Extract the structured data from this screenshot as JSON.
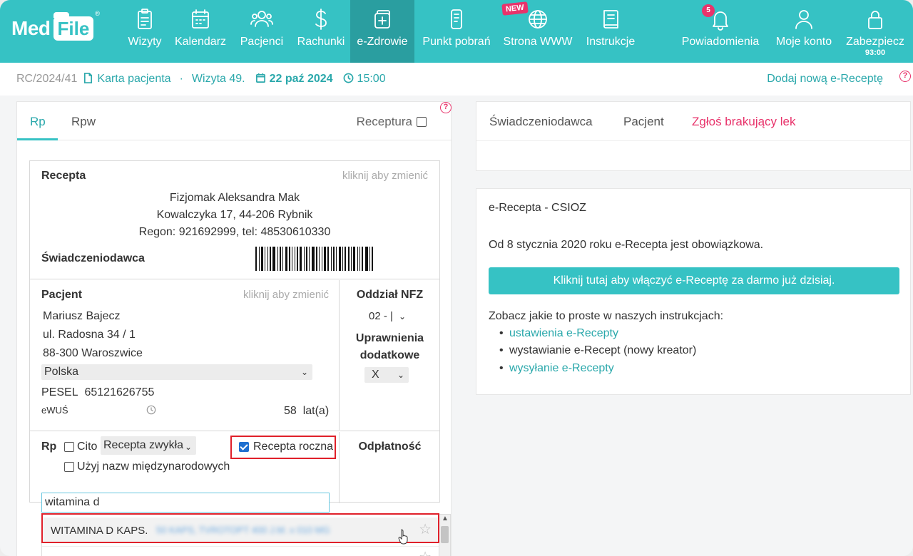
{
  "brand": {
    "logo_part1": "Med",
    "logo_part2": "File",
    "reg_mark": "®"
  },
  "nav": {
    "items": [
      {
        "label": "Wizyty",
        "icon": "clipboard-icon"
      },
      {
        "label": "Kalendarz",
        "icon": "calendar-icon"
      },
      {
        "label": "Pacjenci",
        "icon": "users-icon"
      },
      {
        "label": "Rachunki",
        "icon": "dollar-icon"
      },
      {
        "label": "e-Zdrowie",
        "icon": "medical-plus-icon",
        "active": true
      },
      {
        "label": "Punkt pobrań",
        "icon": "test-tube-icon"
      },
      {
        "label": "Strona WWW",
        "icon": "globe-icon",
        "badge": "NEW"
      },
      {
        "label": "Instrukcje",
        "icon": "book-icon"
      }
    ],
    "right_items": [
      {
        "label": "Powiadomienia",
        "icon": "bell-icon",
        "count": "5"
      },
      {
        "label": "Moje konto",
        "icon": "user-icon"
      },
      {
        "label": "Zabezpiecz",
        "icon": "lock-icon",
        "timer": "93:00"
      }
    ]
  },
  "breadcrumb": {
    "id": "RC/2024/41",
    "card": "Karta pacjenta",
    "sep": "·",
    "visit": "Wizyta 49.",
    "date": "22 paź 2024",
    "time": "15:00",
    "right_link": "Dodaj nową e-Receptę",
    "help": "?"
  },
  "left": {
    "tabs": [
      "Rp",
      "Rpw"
    ],
    "receptura_label": "Receptura",
    "help": "?",
    "recepta": {
      "title": "Recepta",
      "hint": "kliknij aby zmienić",
      "lines": [
        "Fizjomak Aleksandra Mak",
        "Kowalczyka  17, 44-206 Rybnik",
        "Regon: 921692999, tel: 48530610330"
      ],
      "provider_label": "Świadczeniodawca"
    },
    "patient": {
      "title": "Pacjent",
      "hint": "kliknij aby zmienić",
      "name": "Mariusz Bajecz",
      "street": "ul. Radosna 34 / 1",
      "city": "88-300 Waroszwice",
      "country": "Polska",
      "pesel_label": "PESEL",
      "pesel": "65121626755",
      "ewus": "eWUŚ",
      "age": "58",
      "age_unit": "lat(a)"
    },
    "nfz": {
      "title": "Oddział NFZ",
      "value": "02 - |",
      "perm_title_1": "Uprawnienia",
      "perm_title_2": "dodatkowe",
      "perm_value": "X"
    },
    "rp": {
      "label": "Rp",
      "cito_label": "Cito",
      "type_value": "Recepta zwykła",
      "annual_label": "Recepta roczna",
      "intl_label": "Użyj nazw międzynarodowych",
      "fee_label": "Odpłatność",
      "search_value": "witamina d",
      "result_text": "WITAMINA D KAPS.",
      "result_blurred": "50 KAPS, TVROTOPT 400 J.M. x 010 MG"
    }
  },
  "right": {
    "tabs": [
      "Świadczeniodawca",
      "Pacjent",
      "Zgłoś brakujący lek"
    ],
    "ereceipt": {
      "title": "e-Recepta - CSIOZ",
      "info": "Od 8 stycznia 2020 roku e-Recepta jest obowiązkowa.",
      "button": "Kliknij tutaj aby włączyć e-Receptę za darmo już dzisiaj.",
      "see_text": "Zobacz jakie to proste w naszych instrukcjach:",
      "links": [
        "ustawienia e-Recepty",
        "wystawianie e-Recept (nowy kreator)",
        "wysyłanie e-Recepty"
      ]
    }
  },
  "colors": {
    "teal": "#36c2c4",
    "teal_dark": "#2a9ea0",
    "pink": "#e8336b",
    "red_highlight": "#e0202a"
  }
}
